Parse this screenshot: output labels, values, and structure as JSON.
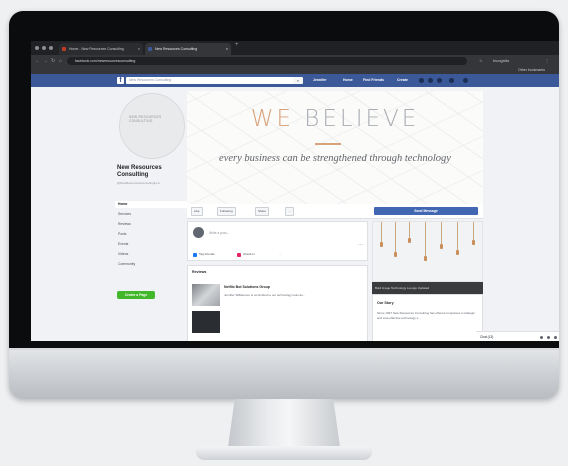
{
  "browser": {
    "tabs": [
      {
        "label": "Home - New Resources Consulting",
        "active": false
      },
      {
        "label": "New Resources Consulting",
        "active": true
      }
    ],
    "new_tab_symbol": "+",
    "close_symbol": "×",
    "url": "facebook.com/newresourcesconsulting",
    "account_label": "Incognito",
    "bookmark_label": "Other bookmarks"
  },
  "facebook": {
    "logo_letter": "f",
    "search_placeholder": "New Resources Consulting",
    "search_icon": "search-icon",
    "nav": [
      "Jennifer",
      "Home",
      "Find Friends",
      "Create"
    ],
    "brand_color": "#3b5998"
  },
  "page": {
    "logo_text": "NEW RESOURCES CONSULTING",
    "name": "New Resources Consulting",
    "handle": "@NewResourcesConsultingLLC",
    "left_nav": [
      "Home",
      "Services",
      "Reviews",
      "Posts",
      "Events",
      "Videos",
      "Community"
    ],
    "cta": "Create a Page",
    "accent_color": "#42b72a"
  },
  "cover": {
    "headline_we": "WE",
    "headline_rest": "BELIEVE",
    "tagline": "every business can be strengthened through technology",
    "accent": "#d9a27a"
  },
  "actions": {
    "buttons": [
      "Like",
      "Following",
      "Share",
      "···"
    ],
    "send_message": "Send Message"
  },
  "composer": {
    "placeholder": "Write a post...",
    "chips": [
      "Tag Friends",
      "Check In",
      "···"
    ],
    "menu": "···"
  },
  "reviews": {
    "heading": "Reviews",
    "items": [
      {
        "title": "Netflix Bot Solutions Group",
        "text": "Jennifer Williamson is committed to our technology tools as..."
      }
    ]
  },
  "sidebar": {
    "caption": "Bold Image Technology Lounge Updated",
    "story_heading": "Our Story",
    "story_text": "Since 1997 New Resources Consulting has offered companies a strategic and cost-effective technology s..."
  },
  "chat": {
    "label": "Chat (13)"
  }
}
